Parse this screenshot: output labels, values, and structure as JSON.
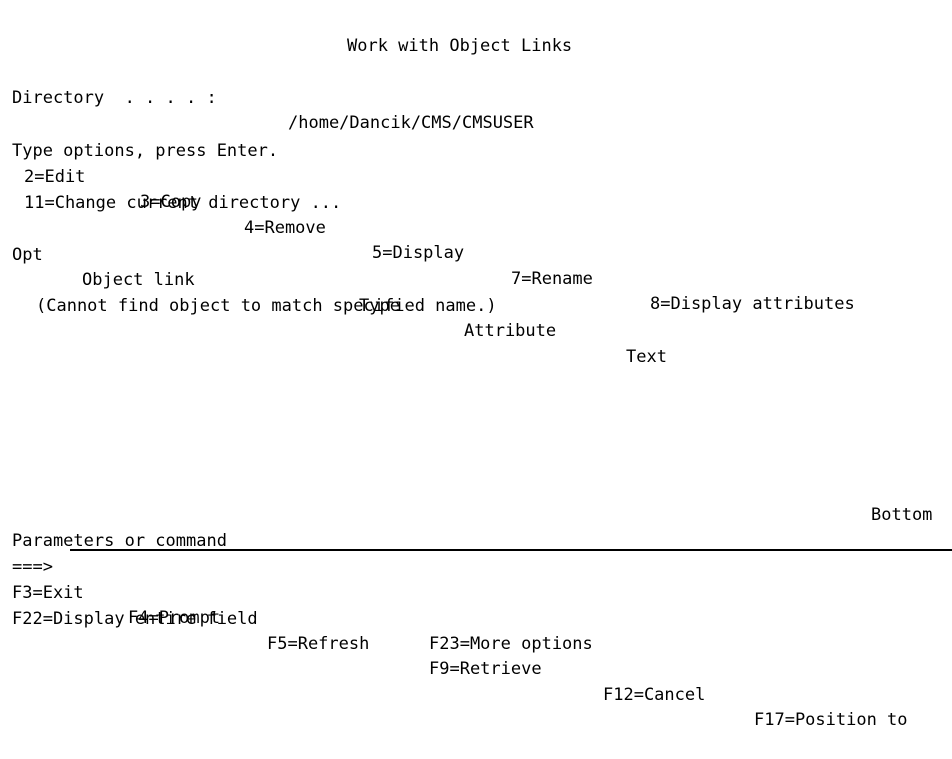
{
  "screen": {
    "title": "Work with Object Links",
    "columns": 80,
    "rows": 24,
    "foreground_color": "#000000",
    "background_color": "#ffffff"
  },
  "header": {
    "directory_label": "Directory  . . . . :",
    "directory_value": "/home/Dancik/CMS/CMSUSER"
  },
  "instructions": {
    "prompt": "Type options, press Enter.",
    "options": [
      "2=Edit",
      "3=Copy",
      "4=Remove",
      "5=Display",
      "7=Rename",
      "8=Display attributes"
    ],
    "options_line2": "11=Change current directory ..."
  },
  "list": {
    "column_headers": {
      "opt": "Opt",
      "object_link": "Object link",
      "type": "Type",
      "attribute": "Attribute",
      "text": "Text"
    },
    "rows": [],
    "empty_message": "(Cannot find object to match specified name.)"
  },
  "status": {
    "more_indicator": "Bottom"
  },
  "command": {
    "label": "Parameters or command",
    "prompt_arrow": "===>",
    "value": "",
    "placeholder": ""
  },
  "function_keys": {
    "line1": [
      "F3=Exit",
      "F4=Prompt",
      "F5=Refresh",
      "F9=Retrieve",
      "F12=Cancel",
      "F17=Position to"
    ],
    "line2": [
      "F22=Display entire field",
      "F23=More options"
    ]
  }
}
